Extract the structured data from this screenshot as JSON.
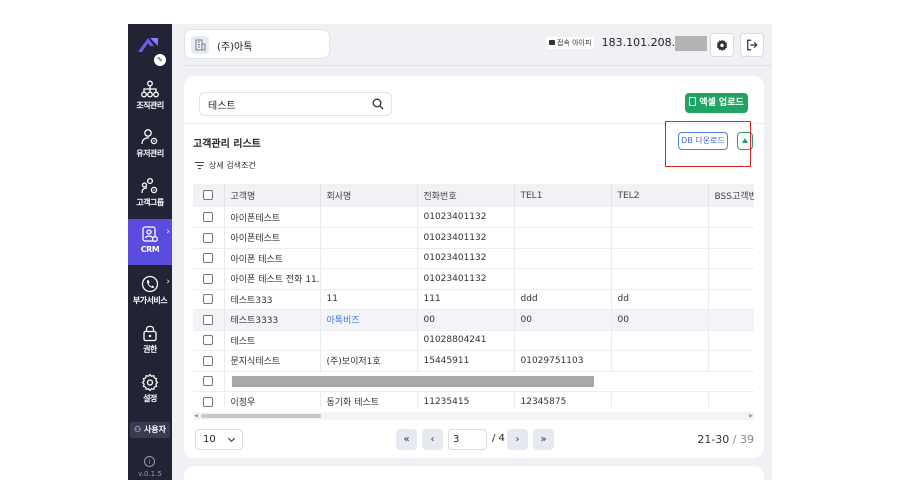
{
  "sidebar": {
    "items": [
      {
        "label": "조직관리",
        "icon": "org-chart-icon"
      },
      {
        "label": "유저관리",
        "icon": "user-gear-icon"
      },
      {
        "label": "고객그룹",
        "icon": "group-gear-icon"
      },
      {
        "label": "CRM",
        "icon": "crm-icon",
        "active": true
      },
      {
        "label": "부가서비스",
        "icon": "phone-icon"
      },
      {
        "label": "권한",
        "icon": "lock-icon"
      },
      {
        "label": "설정",
        "icon": "gear-icon"
      }
    ],
    "user_button": "사용자",
    "version": "v.0.1.5"
  },
  "header": {
    "company": "(주)아톡",
    "ip_label": "접속 아이피",
    "ip": "183.101.208.16"
  },
  "search": {
    "value": "테스트"
  },
  "toolbar": {
    "excel_upload": "엑셀 업로드",
    "db_download": "DB 다운로드"
  },
  "list": {
    "title": "고객관리 리스트",
    "filter_label": "상세 검색조건",
    "columns": [
      "고객명",
      "회사명",
      "전화번호",
      "TEL1",
      "TEL2",
      "BSS고객번"
    ],
    "rows": [
      [
        "아이폰테스트",
        "",
        "01023401132",
        "",
        "",
        ""
      ],
      [
        "아이폰테스트",
        "",
        "01023401132",
        "",
        "",
        ""
      ],
      [
        "아이폰 테스트",
        "",
        "01023401132",
        "",
        "",
        ""
      ],
      [
        "아이폰 테스트 전화 11...",
        "",
        "01023401132",
        "",
        "",
        ""
      ],
      [
        "테스트333",
        "11",
        "111",
        "ddd",
        "dd",
        ""
      ],
      [
        "테스트3333",
        "아톡비즈",
        "00",
        "00",
        "00",
        ""
      ],
      [
        "테스트",
        "",
        "01028804241",
        "",
        "",
        ""
      ],
      [
        "문지식테스트",
        "(주)보이저1호",
        "15445911",
        "01029751103",
        "",
        ""
      ],
      [
        "",
        "",
        "",
        "",
        "",
        ""
      ],
      [
        "이정우",
        "동기화 테스트",
        "11235415",
        "12345875",
        "",
        ""
      ]
    ]
  },
  "pagination": {
    "per_page": "10",
    "current": "3",
    "total_pages": "/ 4",
    "range": "21-30",
    "range_sep": " / ",
    "total": "39"
  },
  "colors": {
    "accent": "#5b4ce0",
    "excel": "#1fa463",
    "link": "#3a7be0",
    "highlight": "#e02020"
  }
}
